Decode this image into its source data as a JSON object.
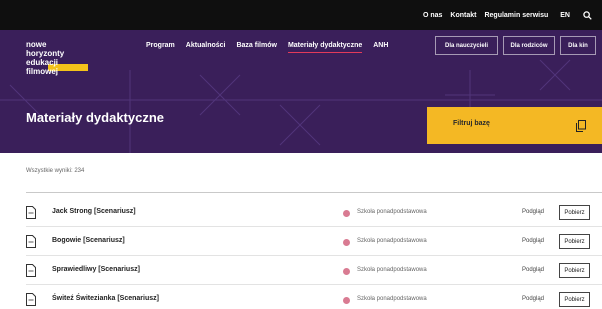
{
  "topbar": {
    "links": [
      "O nas",
      "Kontakt",
      "Regulamin serwisu"
    ],
    "language": "EN",
    "search_icon": "search-icon"
  },
  "logo": {
    "lines": [
      "nowe",
      "horyzonty",
      "edukacji",
      "filmowej"
    ],
    "accent": "#f4c21a"
  },
  "nav": {
    "items": [
      "Program",
      "Aktualności",
      "Baza filmów",
      "Materiały dydaktyczne",
      "ANH"
    ],
    "active": "Materiały dydaktyczne"
  },
  "audience": {
    "buttons": [
      "Dla nauczycieli",
      "Dla rodziców",
      "Dla kin"
    ]
  },
  "header": {
    "title": "Materiały dydaktyczne",
    "background": "#3a1f5a"
  },
  "filter": {
    "label": "Filtruj bazę",
    "icon": "copy-icon",
    "color": "#f4b824"
  },
  "results": {
    "count_text": "Wszystkie wyniki: 234",
    "items": [
      {
        "title": "Jack Strong [Scenariusz]",
        "level": "Szkoła ponadpodstawowa",
        "preview": "Podgląd",
        "download": "Pobierz"
      },
      {
        "title": "Bogowie [Scenariusz]",
        "level": "Szkoła ponadpodstawowa",
        "preview": "Podgląd",
        "download": "Pobierz"
      },
      {
        "title": "Sprawiedliwy [Scenariusz]",
        "level": "Szkoła ponadpodstawowa",
        "preview": "Podgląd",
        "download": "Pobierz"
      },
      {
        "title": "Świteź Świtezianka [Scenariusz]",
        "level": "Szkoła ponadpodstawowa",
        "preview": "Podgląd",
        "download": "Pobierz"
      }
    ],
    "icon": "document-icon",
    "level_dot_color": "#d97b92"
  }
}
